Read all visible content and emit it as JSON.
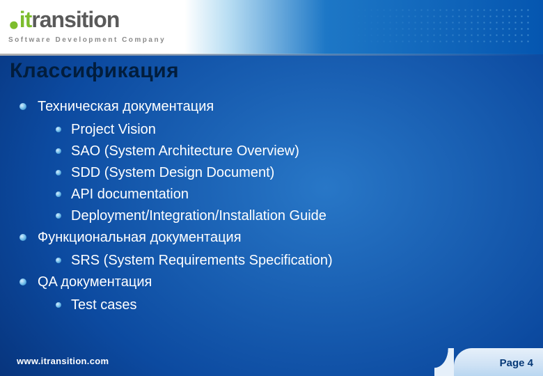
{
  "logo": {
    "word_prefix": "it",
    "word_suffix": "ransition",
    "tagline": "Software Development Company"
  },
  "title": "Классификация",
  "sections": [
    {
      "label": "Техническая документация",
      "items": [
        "Project Vision",
        "SAO (System Architecture Overview)",
        "SDD (System Design Document)",
        "API documentation",
        "Deployment/Integration/Installation Guide"
      ]
    },
    {
      "label": "Функциональная документация",
      "items": [
        "SRS (System Requirements Specification)"
      ]
    },
    {
      "label": "QA документация",
      "items": [
        "Test cases"
      ]
    }
  ],
  "footer": {
    "url": "www.itransition.com",
    "page_label": "Page 4"
  }
}
